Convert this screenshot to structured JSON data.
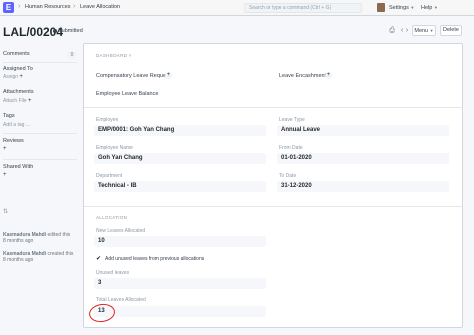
{
  "navbar": {
    "logo": "E",
    "breadcrumbs": [
      "Human Resources",
      "Leave Allocation"
    ],
    "search_placeholder": "Search or type a command (Ctrl + G)",
    "settings_label": "Settings",
    "help_label": "Help"
  },
  "page": {
    "title": "LAL/00204",
    "status": "Submitted",
    "menu_label": "Menu",
    "delete_label": "Delete"
  },
  "sidebar": {
    "comments_label": "Comments",
    "comments_count": "0",
    "assigned_to_label": "Assigned To",
    "assign_label": "Assign",
    "attachments_label": "Attachments",
    "attach_file_label": "Attach File",
    "tags_label": "Tags",
    "add_tag_label": "Add a tag ...",
    "reviews_label": "Reviews",
    "shared_with_label": "Shared With",
    "activity": [
      {
        "name": "Kasmadura Mahdi",
        "action": "edited this",
        "time": "8 months ago"
      },
      {
        "name": "Kasmadura Mahdi",
        "action": "created this",
        "time": "8 months ago"
      }
    ]
  },
  "form": {
    "dashboard_label": "DASHBOARD",
    "comp_leave_request_label": "Compensatory Leave Request",
    "leave_encashment_label": "Leave Encashment",
    "employee_leave_balance_label": "Employee Leave Balance",
    "employee_label": "Employee",
    "employee_value": "EMP/0001: Goh Yan Chang",
    "leave_type_label": "Leave Type",
    "leave_type_value": "Annual Leave",
    "employee_name_label": "Employee Name",
    "employee_name_value": "Goh Yan Chang",
    "from_date_label": "From Date",
    "from_date_value": "01-01-2020",
    "department_label": "Department",
    "department_value": "Technical - IB",
    "to_date_label": "To Date",
    "to_date_value": "31-12-2020",
    "allocation_label": "ALLOCATION",
    "new_leaves_label": "New Leaves Allocated",
    "new_leaves_value": "10",
    "add_unused_label": "Add unused leaves from previous allocations",
    "unused_leaves_label": "Unused leaves",
    "unused_leaves_value": "3",
    "total_leaves_label": "Total Leaves Allocated",
    "total_leaves_value": "13"
  },
  "colors": {
    "accent": "#5e64ff",
    "annotation_circle": "#e02020"
  }
}
